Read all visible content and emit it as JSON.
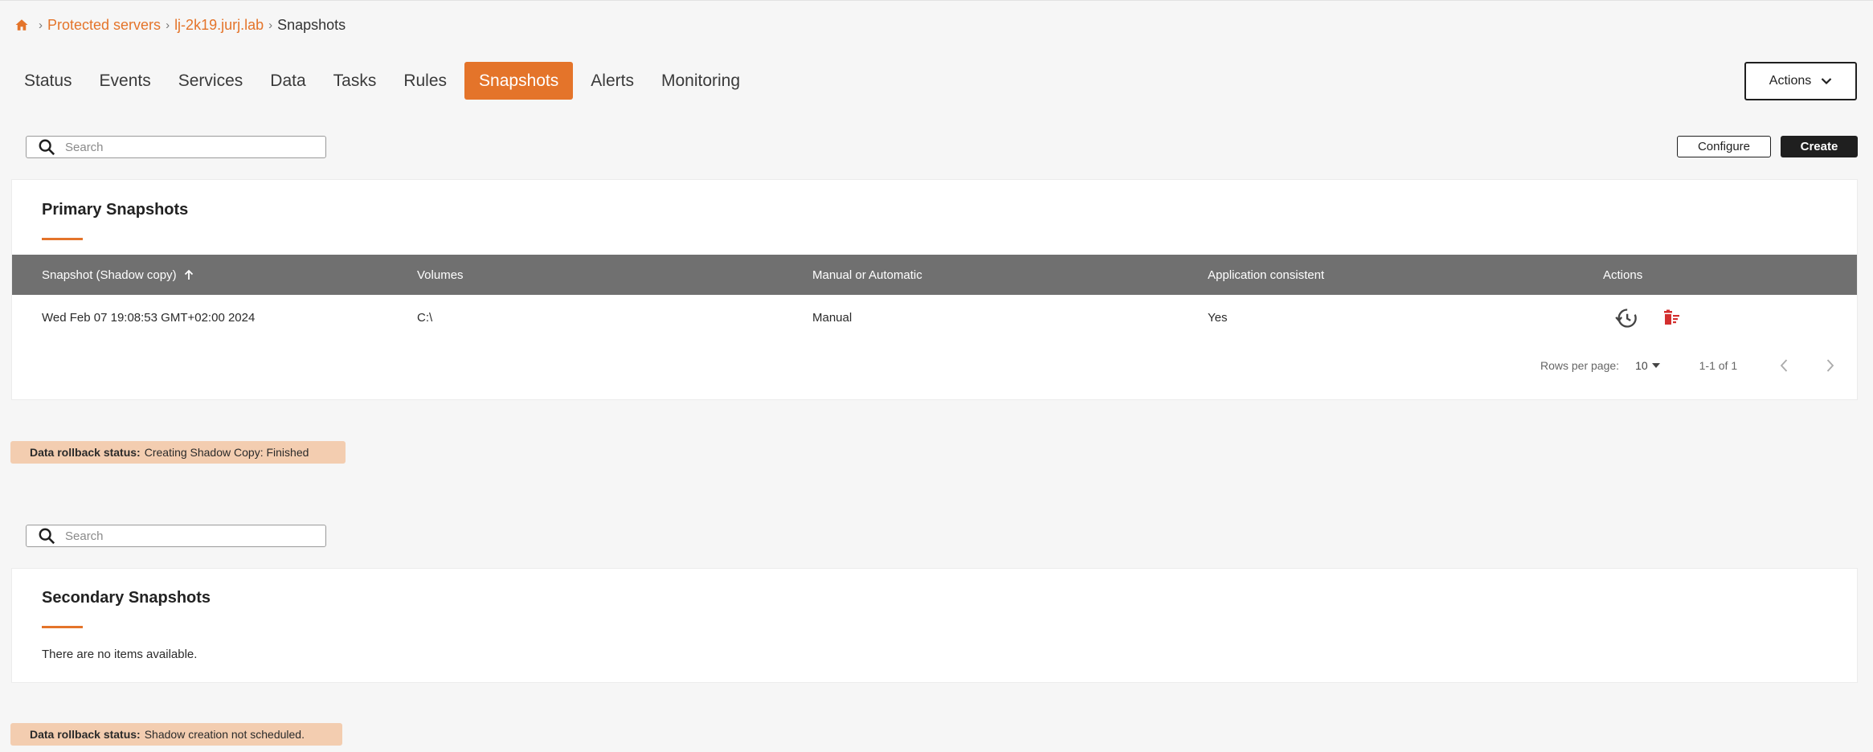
{
  "breadcrumb": {
    "items": [
      "Protected servers",
      "lj-2k19.jurj.lab"
    ],
    "current": "Snapshots"
  },
  "tabs": [
    {
      "label": "Status",
      "active": false
    },
    {
      "label": "Events",
      "active": false
    },
    {
      "label": "Services",
      "active": false
    },
    {
      "label": "Data",
      "active": false
    },
    {
      "label": "Tasks",
      "active": false
    },
    {
      "label": "Rules",
      "active": false
    },
    {
      "label": "Snapshots",
      "active": true
    },
    {
      "label": "Alerts",
      "active": false
    },
    {
      "label": "Monitoring",
      "active": false
    }
  ],
  "header": {
    "actions_label": "Actions"
  },
  "toolbar": {
    "configure_label": "Configure",
    "create_label": "Create"
  },
  "primary": {
    "search_placeholder": "Search",
    "title": "Primary Snapshots",
    "columns": [
      "Snapshot (Shadow copy)",
      "Volumes",
      "Manual or Automatic",
      "Application consistent",
      "Actions"
    ],
    "rows": [
      {
        "snapshot": "Wed Feb 07 19:08:53 GMT+02:00 2024",
        "volume": "C:\\",
        "mode": "Manual",
        "consistent": "Yes"
      }
    ],
    "pagination": {
      "rows_per_page_label": "Rows per page:",
      "rows_per_page": "10",
      "range": "1-1 of 1"
    },
    "rollback_label": "Data rollback status:",
    "rollback_status": "Creating Shadow Copy: Finished"
  },
  "secondary": {
    "search_placeholder": "Search",
    "title": "Secondary Snapshots",
    "empty_text": "There are no items available.",
    "rollback_label": "Data rollback status:",
    "rollback_status": "Shadow creation not scheduled."
  },
  "colors": {
    "accent": "#e4742a",
    "table_header": "#707070",
    "status_bg": "#f3cdb0",
    "danger": "#d32f2f"
  }
}
